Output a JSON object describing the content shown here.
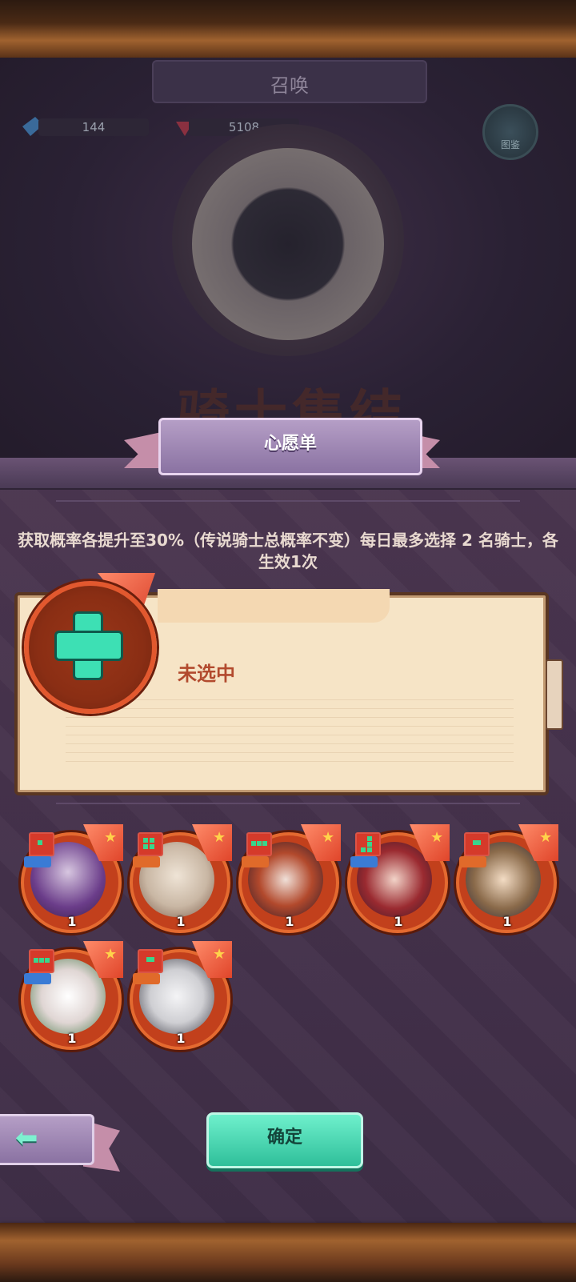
{
  "header": {
    "title": "召唤"
  },
  "resources": [
    {
      "name": "ticket",
      "value": "144",
      "color": "#4a8fd0"
    },
    {
      "name": "gem",
      "value": "5108",
      "color": "#c0405a"
    }
  ],
  "catalog": {
    "label": "图鉴"
  },
  "banner": {
    "title": "骑士集结"
  },
  "wishlist": {
    "title": "心愿单",
    "description": "获取概率各提升至30%（传说骑士总概率不变）每日最多选择 2 名骑士，各生效1次",
    "slot_status": "未选中"
  },
  "heroes": [
    {
      "level": "1",
      "portrait_color": "#6b3d8a",
      "class_icon": "sword-icon"
    },
    {
      "level": "1",
      "portrait_color": "#c9b7a4",
      "class_icon": "sword-icon"
    },
    {
      "level": "1",
      "portrait_color": "#b2492c",
      "class_icon": "sword-icon"
    },
    {
      "level": "1",
      "portrait_color": "#9a2a30",
      "class_icon": "sword-icon"
    },
    {
      "level": "1",
      "portrait_color": "#8a6a4a",
      "class_icon": "sword-icon"
    },
    {
      "level": "1",
      "portrait_color": "#e0d6d4",
      "class_icon": "heart-icon"
    },
    {
      "level": "1",
      "portrait_color": "#cfcfd3",
      "class_icon": "sword-icon"
    }
  ],
  "footer": {
    "confirm_label": "确定",
    "back_icon": "arrow-left-icon"
  },
  "colors": {
    "accent_teal": "#3de0b4",
    "card_paper": "#f6e4c6",
    "panel": "#4b3650"
  }
}
